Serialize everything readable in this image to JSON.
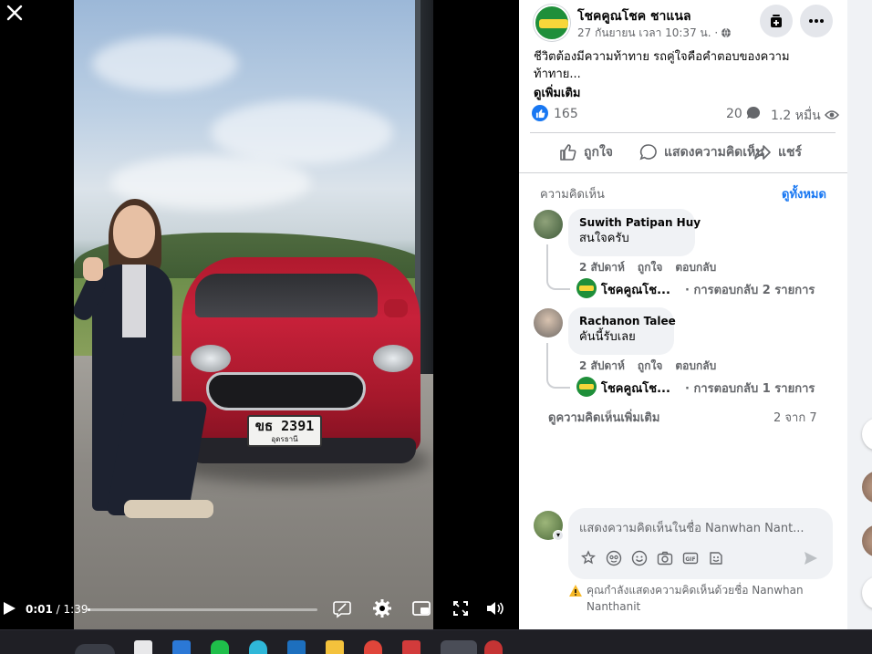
{
  "video": {
    "time_current": "0:01",
    "time_total": "1:39",
    "time_separator": " / ",
    "progress_fraction": 0.006,
    "plate_number": "ขธ 2391",
    "plate_province": "อุดรธานี"
  },
  "post": {
    "page_name": "โชคคูณโชค ชาแนล",
    "date": "27 กันยายน เวลา 10:37 น. ·",
    "caption": "ชีวิตต้องมีความท้าทาย รถคู่ใจคือคำตอบของความท้าทาย...",
    "see_more": "ดูเพิ่มเติม",
    "likes": "165",
    "comments": "20",
    "views": "1.2 หมื่น"
  },
  "actions": {
    "like": "ถูกใจ",
    "comment": "แสดงความคิดเห็น",
    "share": "แชร์"
  },
  "comments_section": {
    "header": "ความคิดเห็น",
    "see_all": "ดูทั้งหมด",
    "items": [
      {
        "author": "Suwith Patipan Huy",
        "text": "สนใจครับ",
        "time": "2 สัปดาห์",
        "like": "ถูกใจ",
        "reply": "ตอบกลับ",
        "reply_author": "โชคคูณโช...",
        "reply_count": "· การตอบกลับ 2 รายการ"
      },
      {
        "author": "Rachanon Talee",
        "text": "คันนี้รับเลย",
        "time": "2 สัปดาห์",
        "like": "ถูกใจ",
        "reply": "ตอบกลับ",
        "reply_author": "โชคคูณโช...",
        "reply_count": "· การตอบกลับ 1 รายการ"
      }
    ],
    "more": "ดูความคิดเห็นเพิ่มเติม",
    "pager": "2 จาก 7"
  },
  "composer": {
    "placeholder": "แสดงความคิดเห็นในชื่อ Nanwhan Nant...",
    "notice": "คุณกำลังแสดงความคิดเห็นด้วยชื่อ Nanwhan Nanthanit"
  },
  "colors": {
    "accent": "#1877f2",
    "text_secondary": "#65676b",
    "bubble": "#f0f2f5"
  }
}
